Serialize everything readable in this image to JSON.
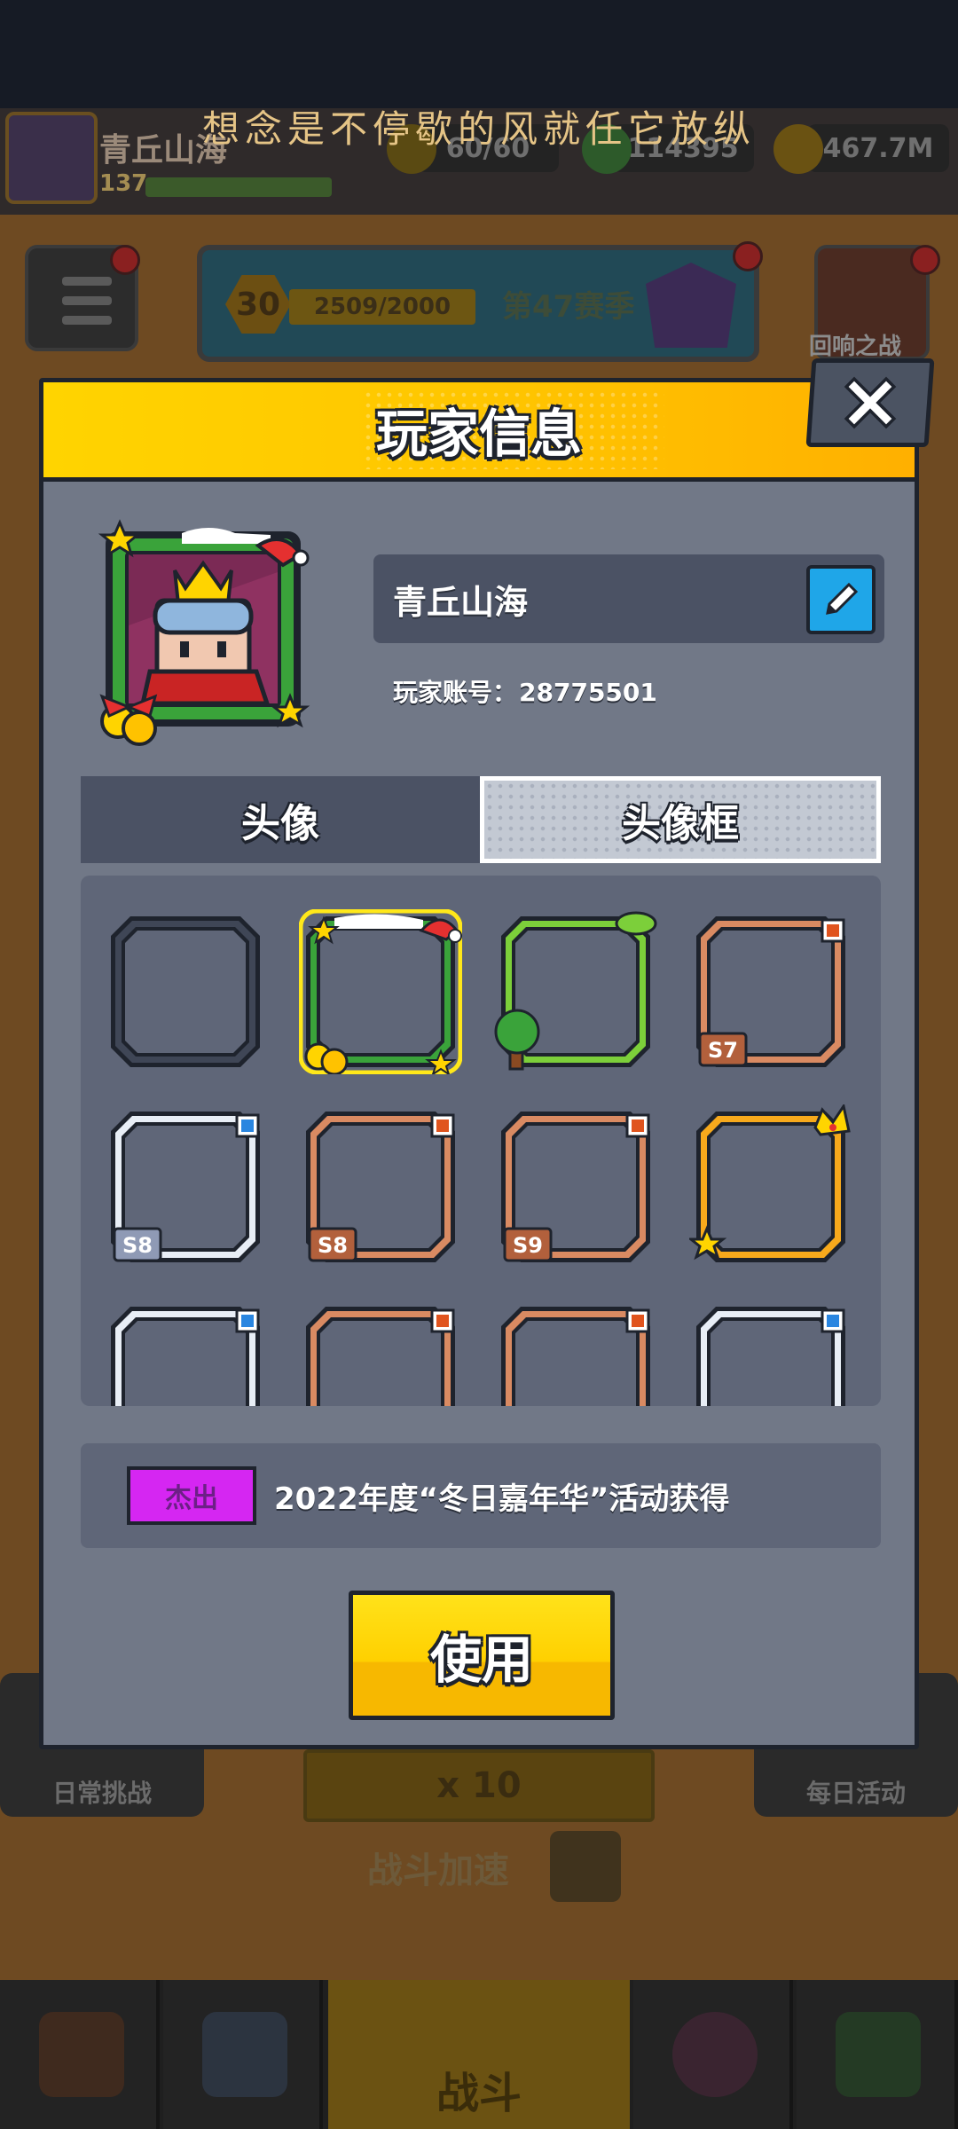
{
  "caption": "想念是不停歇的风就任它放纵",
  "background": {
    "player_name": "青丘山海",
    "player_level": "137",
    "stamina": "60/60",
    "gems": "114395",
    "gold": "467.7M",
    "season_level": "30",
    "season_progress": "2509/2000",
    "season_label": "第47赛季",
    "echo_battle": "回响之战",
    "daily_challenge": "日常挑战",
    "daily_activity": "每日活动",
    "speed_multiplier": "x 10",
    "battle_speed": "战斗加速",
    "nav_battle": "战斗"
  },
  "modal": {
    "title": "玩家信息",
    "player_name": "青丘山海",
    "account_label": "玩家账号：",
    "account_id": "28775501",
    "tabs": [
      "头像",
      "头像框"
    ],
    "selected_tab": "头像框",
    "frames": [
      {
        "style": "empty",
        "label": ""
      },
      {
        "style": "christmas",
        "label": ""
      },
      {
        "style": "forest",
        "label": ""
      },
      {
        "style": "bronze",
        "label": "S7"
      },
      {
        "style": "silver",
        "label": "S8"
      },
      {
        "style": "bronze",
        "label": "S8"
      },
      {
        "style": "bronze",
        "label": "S9"
      },
      {
        "style": "gold-crown",
        "label": ""
      },
      {
        "style": "silver",
        "label": ""
      },
      {
        "style": "bronze",
        "label": ""
      },
      {
        "style": "bronze",
        "label": ""
      },
      {
        "style": "silver",
        "label": ""
      }
    ],
    "rarity": "杰出",
    "rarity_color": "#d526f2",
    "obtain_text": "2022年度“冬日嘉年华”活动获得",
    "use_button": "使用"
  },
  "colors": {
    "header_yellow": "#ffcc00",
    "panel_gray": "#717887",
    "accent_blue": "#1fa6e8"
  }
}
